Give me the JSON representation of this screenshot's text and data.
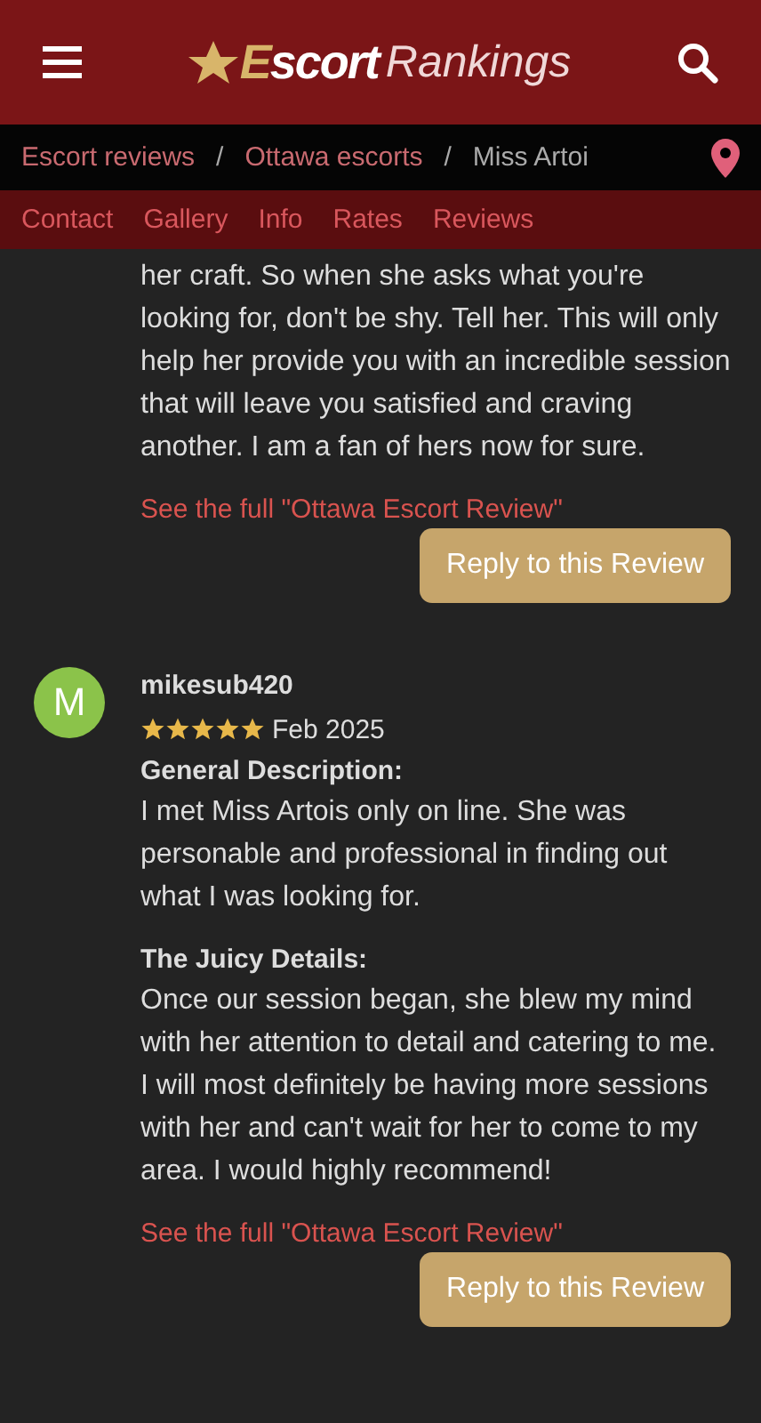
{
  "header": {
    "brand_bold": "Escort",
    "brand_light": "Rankings"
  },
  "breadcrumbs": [
    "Escort reviews",
    "Ottawa escorts",
    "Miss Artoi"
  ],
  "breadcrumb_separator": "/",
  "tabs": [
    "Contact",
    "Gallery",
    "Info",
    "Rates",
    "Reviews"
  ],
  "reviews": [
    {
      "sections": [
        {
          "text": "her craft. So when she asks what you're looking for, don't be shy. Tell her. This will only help her provide you with an incredible session that will leave you satisfied and craving another. I am a fan of hers now for sure."
        }
      ],
      "full_link": "See the full \"Ottawa Escort Review\"",
      "reply": "Reply to this Review"
    },
    {
      "avatar": "M",
      "color": "#8bc34a",
      "user": "mikesub420",
      "stars": 5,
      "date": "Feb 2025",
      "sections": [
        {
          "heading": "General Description:",
          "text": "I met Miss Artois only on line. She was personable and professional in finding out what I was looking for."
        },
        {
          "heading": "The Juicy Details:",
          "text": "Once our session began, she blew my mind with her attention to detail and catering to me. I will most definitely be having more sessions with her and can't wait for her to come to my area. I would highly recommend!"
        }
      ],
      "full_link": "See the full \"Ottawa Escort Review\"",
      "reply": "Reply to this Review"
    }
  ]
}
